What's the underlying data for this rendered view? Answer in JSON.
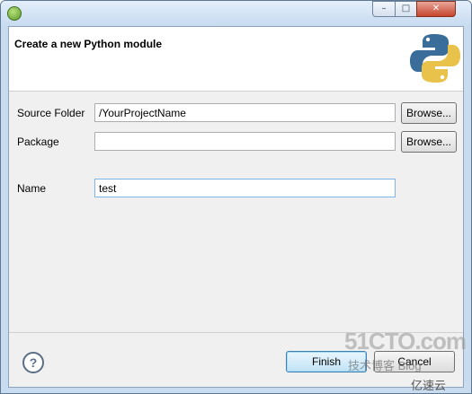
{
  "window": {
    "controls": {
      "minimize": "–",
      "maximize": "□",
      "close": "✕"
    }
  },
  "banner": {
    "title": "Create a new Python module",
    "logo": "python-logo"
  },
  "form": {
    "source_folder": {
      "label": "Source Folder",
      "value": "/YourProjectName",
      "browse": "Browse..."
    },
    "package": {
      "label": "Package",
      "value": "",
      "browse": "Browse..."
    },
    "name": {
      "label": "Name",
      "value": "test"
    }
  },
  "footer": {
    "help": "?",
    "finish": "Finish",
    "cancel": "Cancel"
  },
  "watermark": {
    "site": "51CTO.com",
    "tagline": "技术博客  Blog",
    "brand": "亿速云"
  }
}
